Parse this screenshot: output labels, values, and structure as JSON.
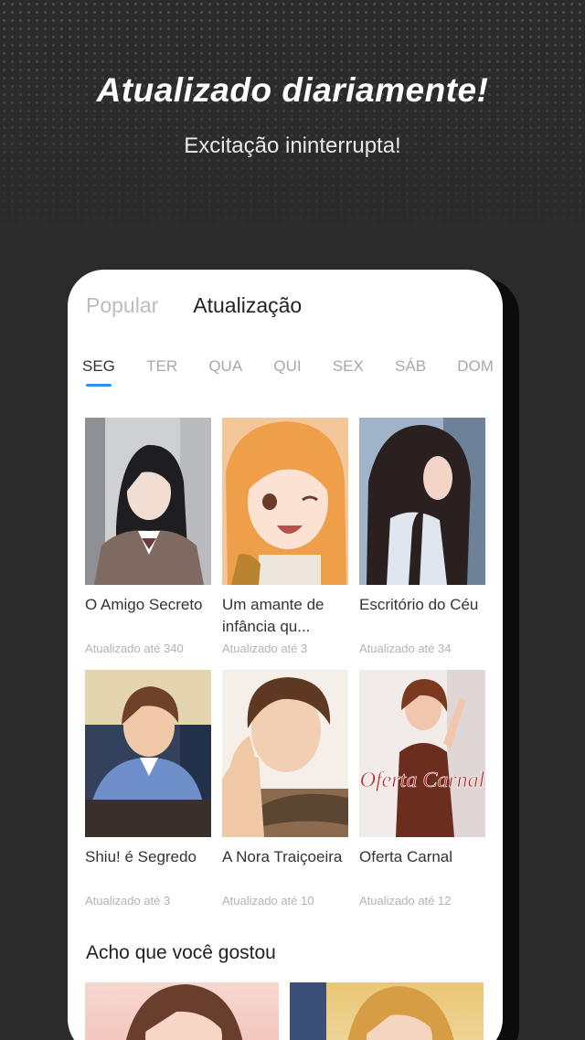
{
  "promo": {
    "headline": "Atualizado diariamente!",
    "subheadline": "Excitação ininterrupta!"
  },
  "tabs": [
    {
      "label": "Popular",
      "active": false
    },
    {
      "label": "Atualização",
      "active": true
    }
  ],
  "days": [
    "SEG",
    "TER",
    "QUA",
    "QUI",
    "SEX",
    "SÁB",
    "DOM"
  ],
  "active_day": "SEG",
  "comics": [
    {
      "title": "O Amigo Secreto",
      "updated": "Atualizado até 340"
    },
    {
      "title": "Um amante de infância qu...",
      "updated": "Atualizado até 3"
    },
    {
      "title": "Escritório do Céu",
      "updated": "Atualizado até 34"
    },
    {
      "title": "Shiu! é Segredo",
      "updated": "Atualizado até 3"
    },
    {
      "title": "A Nora Traiçoeira",
      "updated": "Atualizado até 10"
    },
    {
      "title": "Oferta Carnal",
      "updated": "Atualizado até 12"
    }
  ],
  "cover_art_text": "Oferta Carnal",
  "section": {
    "title": "Acho que você gostou"
  },
  "colors": {
    "accent": "#2d8ff0",
    "background": "#2b2b2b"
  }
}
